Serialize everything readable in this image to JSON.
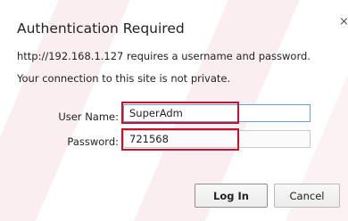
{
  "dialog": {
    "title": "Authentication Required",
    "close_glyph": "×",
    "message_line1": "http://192.168.1.127 requires a username and password.",
    "message_line2": "Your connection to this site is not private."
  },
  "form": {
    "username_label": "User Name:",
    "username_value": "SuperAdm",
    "password_label": "Password:",
    "password_value": "721568"
  },
  "buttons": {
    "login_label": "Log In",
    "cancel_label": "Cancel"
  },
  "colors": {
    "highlight_border": "#c8102e",
    "watermark_stripes": "#c8102e"
  },
  "icons": [
    "close-icon"
  ]
}
